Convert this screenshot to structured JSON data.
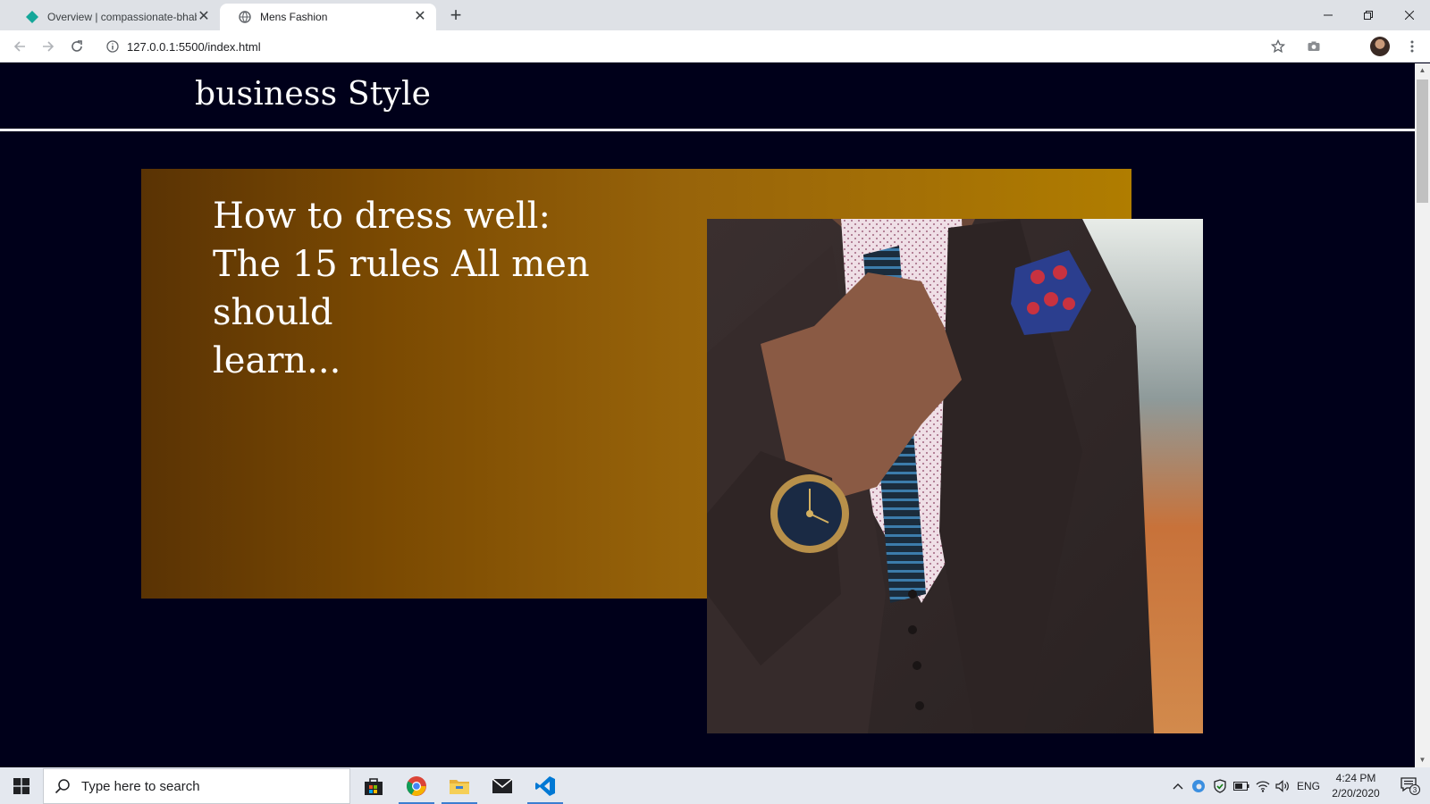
{
  "browser": {
    "tabs": [
      {
        "title": "Overview | compassionate-bhabh",
        "active": false
      },
      {
        "title": "Mens Fashion",
        "active": true
      }
    ],
    "new_tab_label": "+",
    "url": "127.0.0.1:5500/index.html"
  },
  "page": {
    "site_title": "business Style",
    "hero_lines": [
      "How to dress well:",
      "The 15 rules All men should",
      "learn..."
    ],
    "colors": {
      "background": "#00001a",
      "hero_gradient_start": "#5a3304",
      "hero_gradient_end": "#b07d00",
      "heading_text": "#ffffff"
    },
    "hero_image": "man in dark suit adjusting tie, wearing wristwatch, pocket square"
  },
  "taskbar": {
    "search_placeholder": "Type here to search",
    "pinned_apps": [
      "store-icon",
      "chrome-icon",
      "file-explorer-icon",
      "mail-icon",
      "vscode-icon"
    ],
    "tray": {
      "language": "ENG",
      "time": "4:24 PM",
      "date": "2/20/2020",
      "notification_count": "3"
    }
  }
}
